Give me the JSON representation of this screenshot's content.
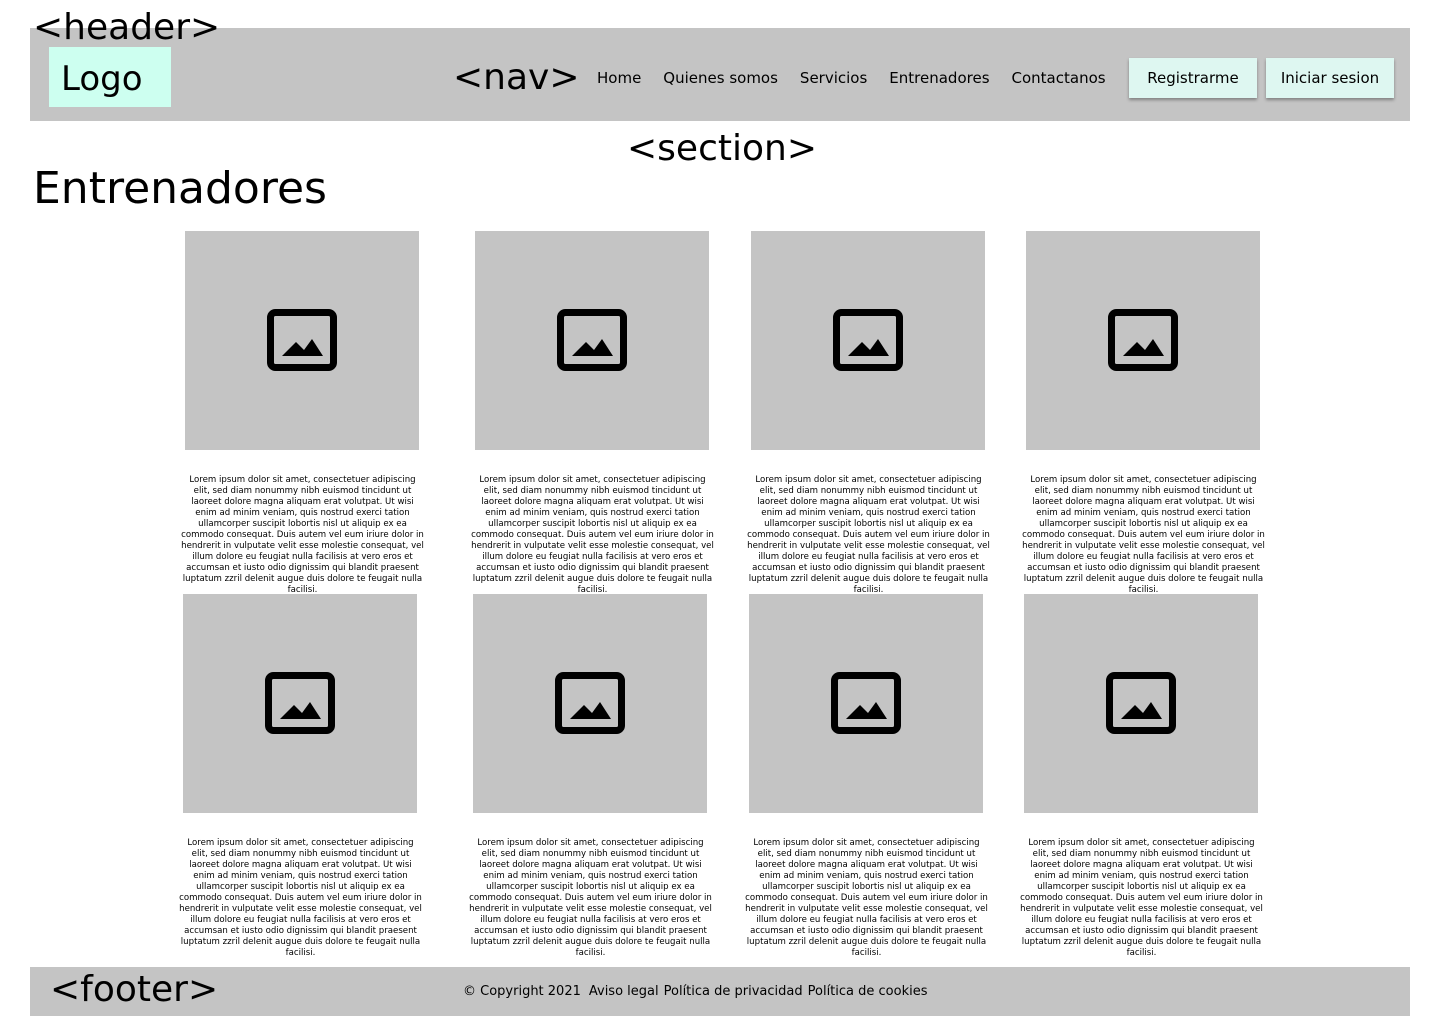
{
  "annotations": {
    "header": "<header>",
    "nav": "<nav>",
    "section": "<section>",
    "footer": "<footer>"
  },
  "header": {
    "logo": "Logo",
    "nav_links": [
      "Home",
      "Quienes somos",
      "Servicios",
      "Entrenadores",
      "Contactanos"
    ],
    "register_label": "Registrarme",
    "login_label": "Iniciar sesion"
  },
  "section": {
    "title": "Entrenadores",
    "cards": [
      {
        "image_icon": "image-placeholder-icon",
        "text": "Lorem ipsum dolor sit amet, consectetuer adipiscing elit, sed diam nonummy nibh euismod tincidunt ut laoreet dolore magna aliquam erat volutpat. Ut wisi enim ad minim veniam, quis nostrud exerci tation ullamcorper suscipit lobortis nisl ut aliquip ex ea commodo consequat. Duis autem vel eum iriure dolor in hendrerit in vulputate velit esse molestie consequat, vel illum dolore eu feugiat nulla facilisis at vero eros et accumsan et iusto odio dignissim qui blandit praesent luptatum zzril delenit augue duis dolore te feugait nulla facilisi."
      },
      {
        "image_icon": "image-placeholder-icon",
        "text": "Lorem ipsum dolor sit amet, consectetuer adipiscing elit, sed diam nonummy nibh euismod tincidunt ut laoreet dolore magna aliquam erat volutpat. Ut wisi enim ad minim veniam, quis nostrud exerci tation ullamcorper suscipit lobortis nisl ut aliquip ex ea commodo consequat. Duis autem vel eum iriure dolor in hendrerit in vulputate velit esse molestie consequat, vel illum dolore eu feugiat nulla facilisis at vero eros et accumsan et iusto odio dignissim qui blandit praesent luptatum zzril delenit augue duis dolore te feugait nulla facilisi."
      },
      {
        "image_icon": "image-placeholder-icon",
        "text": "Lorem ipsum dolor sit amet, consectetuer adipiscing elit, sed diam nonummy nibh euismod tincidunt ut laoreet dolore magna aliquam erat volutpat. Ut wisi enim ad minim veniam, quis nostrud exerci tation ullamcorper suscipit lobortis nisl ut aliquip ex ea commodo consequat. Duis autem vel eum iriure dolor in hendrerit in vulputate velit esse molestie consequat, vel illum dolore eu feugiat nulla facilisis at vero eros et accumsan et iusto odio dignissim qui blandit praesent luptatum zzril delenit augue duis dolore te feugait nulla facilisi."
      },
      {
        "image_icon": "image-placeholder-icon",
        "text": "Lorem ipsum dolor sit amet, consectetuer adipiscing elit, sed diam nonummy nibh euismod tincidunt ut laoreet dolore magna aliquam erat volutpat. Ut wisi enim ad minim veniam, quis nostrud exerci tation ullamcorper suscipit lobortis nisl ut aliquip ex ea commodo consequat. Duis autem vel eum iriure dolor in hendrerit in vulputate velit esse molestie consequat, vel illum dolore eu feugiat nulla facilisis at vero eros et accumsan et iusto odio dignissim qui blandit praesent luptatum zzril delenit augue duis dolore te feugait nulla facilisi."
      },
      {
        "image_icon": "image-placeholder-icon",
        "text": "Lorem ipsum dolor sit amet, consectetuer adipiscing elit, sed diam nonummy nibh euismod tincidunt ut laoreet dolore magna aliquam erat volutpat. Ut wisi enim ad minim veniam, quis nostrud exerci tation ullamcorper suscipit lobortis nisl ut aliquip ex ea commodo consequat. Duis autem vel eum iriure dolor in hendrerit in vulputate velit esse molestie consequat, vel illum dolore eu feugiat nulla facilisis at vero eros et accumsan et iusto odio dignissim qui blandit praesent luptatum zzril delenit augue duis dolore te feugait nulla facilisi."
      },
      {
        "image_icon": "image-placeholder-icon",
        "text": "Lorem ipsum dolor sit amet, consectetuer adipiscing elit, sed diam nonummy nibh euismod tincidunt ut laoreet dolore magna aliquam erat volutpat. Ut wisi enim ad minim veniam, quis nostrud exerci tation ullamcorper suscipit lobortis nisl ut aliquip ex ea commodo consequat. Duis autem vel eum iriure dolor in hendrerit in vulputate velit esse molestie consequat, vel illum dolore eu feugiat nulla facilisis at vero eros et accumsan et iusto odio dignissim qui blandit praesent luptatum zzril delenit augue duis dolore te feugait nulla facilisi."
      },
      {
        "image_icon": "image-placeholder-icon",
        "text": "Lorem ipsum dolor sit amet, consectetuer adipiscing elit, sed diam nonummy nibh euismod tincidunt ut laoreet dolore magna aliquam erat volutpat. Ut wisi enim ad minim veniam, quis nostrud exerci tation ullamcorper suscipit lobortis nisl ut aliquip ex ea commodo consequat. Duis autem vel eum iriure dolor in hendrerit in vulputate velit esse molestie consequat, vel illum dolore eu feugiat nulla facilisis at vero eros et accumsan et iusto odio dignissim qui blandit praesent luptatum zzril delenit augue duis dolore te feugait nulla facilisi."
      },
      {
        "image_icon": "image-placeholder-icon",
        "text": "Lorem ipsum dolor sit amet, consectetuer adipiscing elit, sed diam nonummy nibh euismod tincidunt ut laoreet dolore magna aliquam erat volutpat. Ut wisi enim ad minim veniam, quis nostrud exerci tation ullamcorper suscipit lobortis nisl ut aliquip ex ea commodo consequat. Duis autem vel eum iriure dolor in hendrerit in vulputate velit esse molestie consequat, vel illum dolore eu feugiat nulla facilisis at vero eros et accumsan et iusto odio dignissim qui blandit praesent luptatum zzril delenit augue duis dolore te feugait nulla facilisi."
      }
    ]
  },
  "footer": {
    "copyright": "© Copyright 2021",
    "links": [
      "Aviso legal",
      "Política de privacidad",
      "Política de cookies"
    ]
  },
  "colors": {
    "panel_gray": "#c4c4c4",
    "logo_bg": "#cdfff0",
    "button_bg": "#def7f1"
  }
}
